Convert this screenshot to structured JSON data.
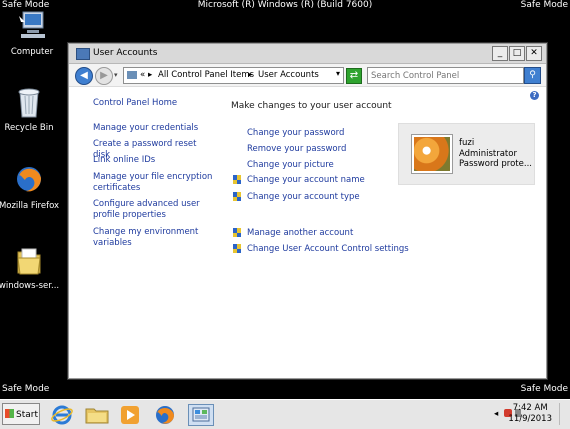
{
  "safe_mode": {
    "top_left": "Safe Mode",
    "top_right": "Safe Mode",
    "bottom_left": "Safe Mode",
    "bottom_right": "Safe Mode"
  },
  "os_banner": "Microsoft (R) Windows (R) (Build 7600)",
  "desktop": {
    "icons": [
      {
        "label": "Computer",
        "icon": "computer-icon"
      },
      {
        "label": "Recycle Bin",
        "icon": "recycle-bin-icon"
      },
      {
        "label": "Mozilla Firefox",
        "icon": "firefox-icon"
      },
      {
        "label": "windows-ser...",
        "icon": "folder-icon"
      }
    ]
  },
  "window": {
    "title": "User Accounts",
    "controls": {
      "minimize": "_",
      "maximize": "□",
      "close": "✕"
    },
    "address": {
      "crumbs": [
        "All Control Panel Items",
        "User Accounts"
      ],
      "separator": "▸",
      "chevron": "«"
    },
    "search": {
      "placeholder": "Search Control Panel"
    },
    "help": "?",
    "left_pane": {
      "home": "Control Panel Home",
      "links": [
        "Manage your credentials",
        "Create a password reset disk",
        "Link online IDs",
        "Manage your file encryption certificates",
        "Configure advanced user profile properties",
        "Change my environment variables"
      ]
    },
    "main": {
      "heading": "Make changes to your user account",
      "tasks": [
        {
          "label": "Change your password",
          "shield": false
        },
        {
          "label": "Remove your password",
          "shield": false
        },
        {
          "label": "Change your picture",
          "shield": false
        },
        {
          "label": "Change your account name",
          "shield": true
        },
        {
          "label": "Change your account type",
          "shield": true
        }
      ],
      "other_tasks": [
        {
          "label": "Manage another account",
          "shield": true
        },
        {
          "label": "Change User Account Control settings",
          "shield": true
        }
      ]
    },
    "user": {
      "name": "fuzi",
      "role": "Administrator",
      "status": "Password prote..."
    }
  },
  "taskbar": {
    "start_label": "Start",
    "items": [
      "internet-explorer-icon",
      "windows-explorer-icon",
      "media-player-icon",
      "firefox-icon",
      "control-panel-icon"
    ],
    "clock": {
      "time": "7:42 AM",
      "date": "11/9/2013"
    }
  },
  "colors": {
    "link": "#1e3a9e",
    "desktop": "#000000",
    "accent": "#3f7fd0"
  }
}
